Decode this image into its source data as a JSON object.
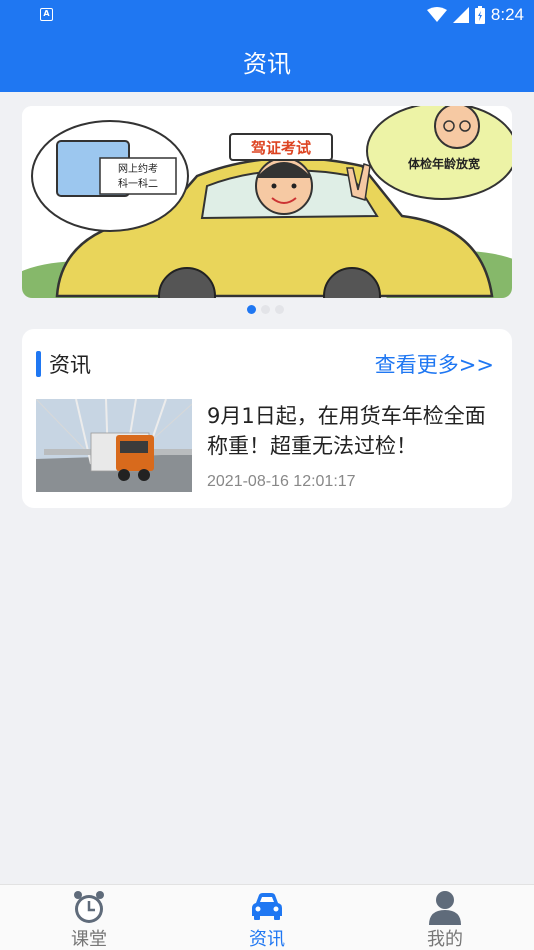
{
  "status_bar": {
    "notification_icon": "a-notification-icon",
    "time": "8:24",
    "icons": [
      "wifi-icon",
      "signal-icon",
      "battery-icon"
    ]
  },
  "header": {
    "title": "资讯"
  },
  "banner": {
    "images": [
      "driving-test-cartoon"
    ],
    "sign_text": "驾证考试",
    "bubble_right_text": "体检年龄放宽",
    "bubble_left_line1": "网上约考",
    "bubble_left_line2": "科一科二",
    "page_count": 3,
    "active_page": 1
  },
  "news_section": {
    "title": "资讯",
    "more_label": "查看更多>>",
    "items": [
      {
        "title": "9月1日起，在用货车年检全面称重！超重无法过检！",
        "time": "2021-08-16 12:01:17",
        "thumbnail": "truck-on-bridge-photo"
      }
    ]
  },
  "tab_bar": {
    "tabs": [
      {
        "label": "课堂",
        "icon": "alarm-clock-icon",
        "active": false
      },
      {
        "label": "资讯",
        "icon": "car-icon",
        "active": true
      },
      {
        "label": "我的",
        "icon": "person-icon",
        "active": false
      }
    ]
  },
  "colors": {
    "primary": "#1f77f2",
    "background": "#f0f1f4",
    "inactive": "#777777"
  }
}
